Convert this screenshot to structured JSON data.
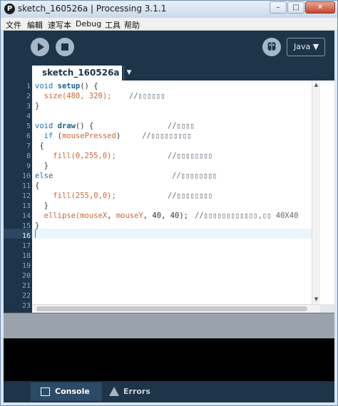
{
  "window": {
    "title": "sketch_160526a | Processing 3.1.1",
    "app_icon_glyph": "P",
    "minimize_glyph": "–",
    "maximize_glyph": "□",
    "close_glyph": "✕"
  },
  "menu": [
    "文件",
    "編輯",
    "速写本",
    "Debug",
    "工具",
    "帮助"
  ],
  "toolbar": {
    "run_icon": "play-icon",
    "stop_icon": "stop-icon",
    "debug_icon": "butterfly-debug-icon",
    "mode_label": "Java ▼"
  },
  "tab": {
    "name": "sketch_160526a",
    "arrow": "▼"
  },
  "editor": {
    "line_numbers": [
      "1",
      "2",
      "3",
      "4",
      "5",
      "6",
      "7",
      "8",
      "9",
      "10",
      "11",
      "12",
      "13",
      "14",
      "15",
      "16",
      "17",
      "18",
      "19",
      "20",
      "21",
      "22",
      "23"
    ],
    "current_line": 16,
    "comments": {
      "c2": "//▯▯▯▯▯▯",
      "c5": "//▯▯▯▯",
      "c6": "//▯▯▯▯▯▯▯▯▯",
      "c8": "//▯▯▯▯▯▯▯▯",
      "c10": "//▯▯▯▯▯▯▯▯",
      "c12": "//▯▯▯▯▯▯▯▯",
      "c14": "//▯▯▯▯▯▯▯▯▯▯▯▯,▯▯ 40X40"
    },
    "tokens": {
      "void": "void",
      "setup": "setup",
      "size_call": "size(480, 320);",
      "draw": "draw",
      "if": "if",
      "mousePressed": "mousePressed",
      "fill_green": "fill(0,255,0);",
      "else": "else",
      "fill_red": "fill(255,0,0);",
      "ellipse": "ellipse(",
      "mouseX": "mouseX",
      "mouseY": "mouseY",
      "ellipse_args": ", 40, 40);"
    }
  },
  "console": {
    "tab_console": "Console",
    "tab_errors": "Errors"
  },
  "colors": {
    "chrome": "#1d3449",
    "keyword": "#1a70b0",
    "builtin": "#cc6633"
  }
}
